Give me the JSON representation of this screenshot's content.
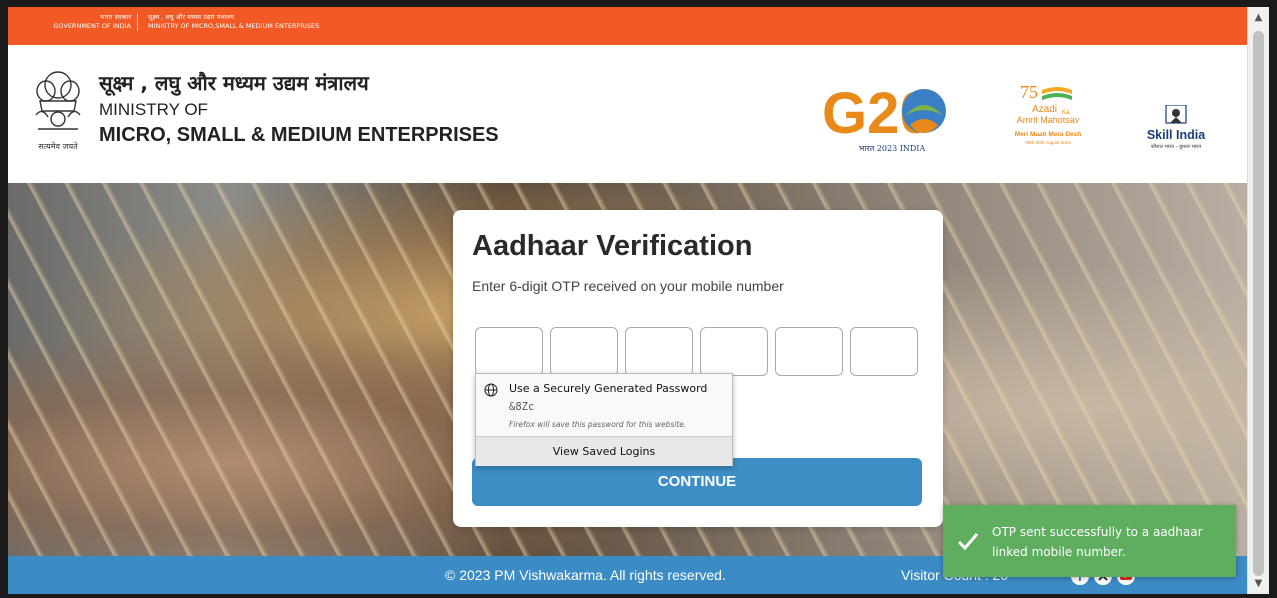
{
  "gov_bar": {
    "left_hi": "भारत सरकार",
    "left_en": "GOVERNMENT OF INDIA",
    "right_hi": "सूक्ष्म , लघु और मध्यम उद्यम मंत्रालय",
    "right_en": "MINISTRY OF MICRO,SMALL & MEDIUM ENTERPRISES",
    "color": "#f15a24"
  },
  "header": {
    "ministry_hi": "सूक्ष्म , लघु और मध्यम उद्यम मंत्रालय",
    "ministry_of": "MINISTRY OF",
    "ministry_en": "MICRO, SMALL & MEDIUM ENTERPRISES",
    "emblem_motto": "सत्यमेव जयते",
    "g20_text": "G20",
    "g20_sub": "भारत 2023 INDIA",
    "azadi_line1": "Azadi",
    "azadi_ka": "Ka",
    "azadi_line2": "Amrit Mahotsav",
    "azadi_line3": "Meri Maati Mera Desh",
    "azadi_line4": "09th-30th August 2023",
    "skill_title": "Skill India",
    "skill_sub": "कौशल भारत - कुशल भारत"
  },
  "card": {
    "title": "Aadhaar Verification",
    "subtitle": "Enter 6-digit OTP received on your mobile number",
    "otp_values": [
      "",
      "",
      "",
      "",
      "",
      ""
    ],
    "continue_label": "CONTINUE"
  },
  "password_popup": {
    "title": "Use a Securely Generated Password",
    "value": "&8Zc",
    "note": "Firefox will save this password for this website.",
    "view_logins": "View Saved Logins",
    "icon": "globe-icon"
  },
  "toast": {
    "message": "OTP sent successfully to a aadhaar linked mobile number.",
    "icon": "check-icon",
    "color": "#5fae5f"
  },
  "footer": {
    "copyright": "© 2023 PM Vishwakarma. All rights reserved.",
    "visitor_label": "Visitor Count : 20",
    "social_icons": [
      "facebook-icon",
      "x-icon",
      "youtube-icon"
    ],
    "color": "#3b8bc4"
  }
}
